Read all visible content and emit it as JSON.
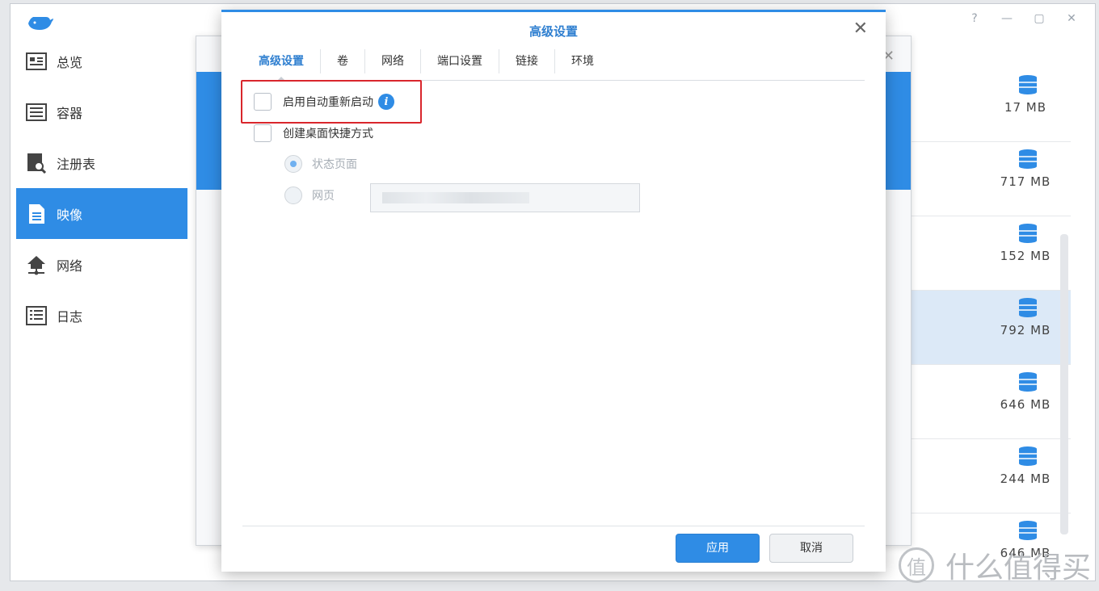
{
  "window": {
    "controls": [
      "?",
      "—",
      "▢",
      "✕"
    ]
  },
  "sidebar": {
    "items": [
      {
        "label": "总览",
        "icon": "overview-icon"
      },
      {
        "label": "容器",
        "icon": "container-icon"
      },
      {
        "label": "注册表",
        "icon": "registry-icon"
      },
      {
        "label": "映像",
        "icon": "image-icon",
        "active": true
      },
      {
        "label": "网络",
        "icon": "network-icon"
      },
      {
        "label": "日志",
        "icon": "log-icon"
      }
    ]
  },
  "image_sizes": [
    "17 MB",
    "717 MB",
    "152 MB",
    "792 MB",
    "646 MB",
    "244 MB",
    "646 MB"
  ],
  "dialog": {
    "title": "高级设置",
    "close": "✕",
    "tabs": [
      "高级设置",
      "卷",
      "网络",
      "端口设置",
      "链接",
      "环境"
    ],
    "options": {
      "auto_restart": "启用自动重新启动",
      "desktop_shortcut": "创建桌面快捷方式",
      "status_page": "状态页面",
      "web_page": "网页"
    },
    "buttons": {
      "apply": "应用",
      "cancel": "取消"
    }
  },
  "watermark": {
    "logo": "值",
    "text": "什么值得买"
  },
  "colors": {
    "accent": "#2f8ce5",
    "highlight": "#d9262c"
  }
}
